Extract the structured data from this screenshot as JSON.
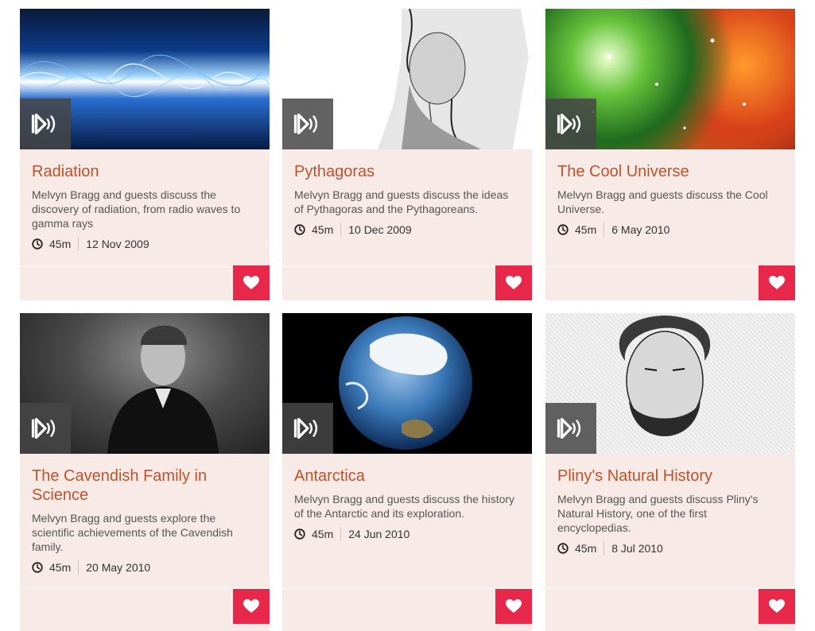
{
  "accent_color": "#c0512a",
  "favourite_color": "#e8284b",
  "episodes": [
    {
      "title": "Radiation",
      "description": "Melvyn Bragg and guests discuss the discovery of radiation, from radio waves to gamma rays",
      "duration": "45m",
      "date": "12 Nov 2009",
      "image": "radiation-waveform-image"
    },
    {
      "title": "Pythagoras",
      "description": "Melvyn Bragg and guests discuss the ideas of Pythagoras and the Pythagoreans.",
      "duration": "45m",
      "date": "10 Dec 2009",
      "image": "pythagoras-engraving-image"
    },
    {
      "title": "The Cool Universe",
      "description": "Melvyn Bragg and guests discuss the Cool Universe.",
      "duration": "45m",
      "date": "6 May 2010",
      "image": "nebula-image"
    },
    {
      "title": "The Cavendish Family in Science",
      "description": "Melvyn Bragg and guests explore the scientific achievements of the Cavendish family.",
      "duration": "45m",
      "date": "20 May 2010",
      "image": "cavendish-portrait-image"
    },
    {
      "title": "Antarctica",
      "description": "Melvyn Bragg and guests discuss the history of the Antarctic and its exploration.",
      "duration": "45m",
      "date": "24 Jun 2010",
      "image": "earth-globe-image"
    },
    {
      "title": "Pliny's Natural History",
      "description": "Melvyn Bragg and guests discuss Pliny's Natural History, one of the first encyclopedias.",
      "duration": "45m",
      "date": "8 Jul 2010",
      "image": "pliny-engraving-image"
    }
  ]
}
